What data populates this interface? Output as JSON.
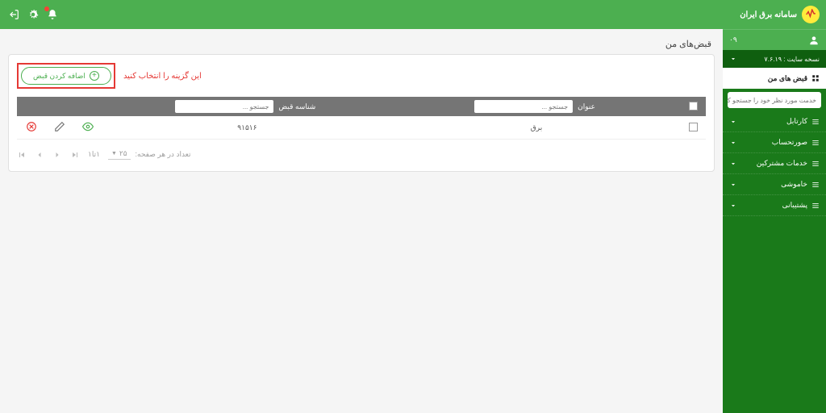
{
  "brand": {
    "title": "سامانه برق ایران"
  },
  "user_row": {
    "phone": "۰۹"
  },
  "version_row": {
    "label": "نسخه سایت : ۷.۶.۱۹"
  },
  "menu_selected": {
    "label": "قبض های من"
  },
  "search": {
    "placeholder": "خدمت مورد نظر خود را جستجو کنید"
  },
  "menu": [
    {
      "label": "کارتابل"
    },
    {
      "label": "صورتحساب"
    },
    {
      "label": "خدمات مشترکین"
    },
    {
      "label": "خاموشی"
    },
    {
      "label": "پشتیبانی"
    }
  ],
  "page": {
    "title": "قبض‌های من"
  },
  "toolbar": {
    "add_label": "اضافه کردن قبض",
    "hint": "این گزینه را انتخاب کنید"
  },
  "table": {
    "col_title": "عنوان",
    "col_billid": "شناسه قبض",
    "search_placeholder": "جستجو ...",
    "rows": [
      {
        "title": "برق",
        "billid": "۹۱۵۱۶"
      }
    ]
  },
  "pager": {
    "range": "۱تا۱",
    "size_label": "تعداد در هر صفحه:",
    "size_value": "۲۵"
  }
}
